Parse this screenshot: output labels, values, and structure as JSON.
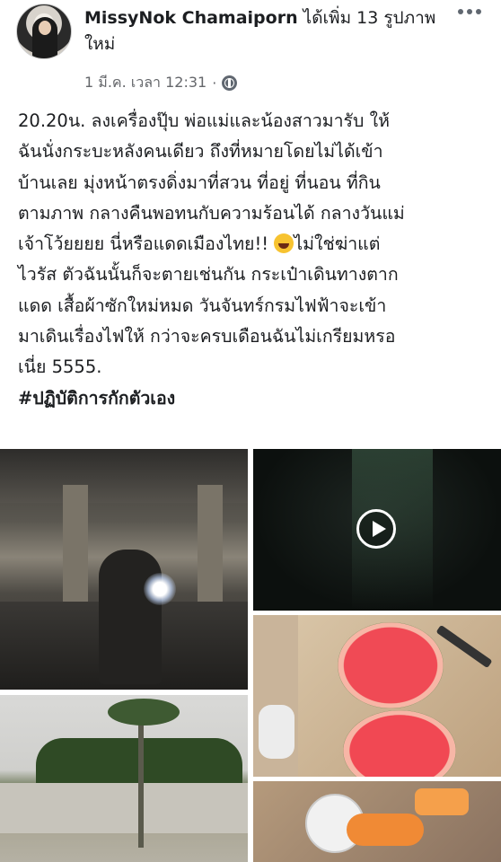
{
  "post": {
    "author": "MissyNok Chamaiporn",
    "action": "ได้เพิ่ม 13 รูปภาพใหม่",
    "timestamp": "1 มี.ค. เวลา 12:31",
    "separator": "·",
    "privacy_icon": "globe-icon",
    "more_icon": "more-options-icon",
    "text_lines": [
      "20.20น. ลงเครื่องปุ๊บ พ่อแม่และน้องสาวมารับ ให้",
      "ฉันนั่งกระบะหลังคนเดียว ถึงที่หมายโดยไม่ได้เข้า",
      "บ้านเลย มุ่งหน้าตรงดิ่งมาที่สวน ที่อยู่ ที่นอน ที่กิน",
      "ตามภาพ กลางคืนพอทนกับความร้อนได้ กลางวันแม่",
      "เจ้าโว้ยยยย นี่หรือแดดเมืองไทย!!",
      "ไม่ใช่ฆ่าแต่",
      "ไวรัส ตัวฉันนั้นก็จะตายเช่นกัน กระเป๋าเดินทางตาก",
      "แดด เสื้อผ้าซักใหม่หมด วันจันทร์กรมไฟฟ้าจะเข้า",
      "มาเดินเรื่องไฟให้ กว่าจะครบเดือนฉันไม่เกรียมหรอ",
      "เนี่ย 5555."
    ],
    "emoji_icon": "laughing-emoji-icon",
    "hashtag": "#ปฏิบัติการกักตัวเอง"
  },
  "gallery": {
    "photos": [
      {
        "name": "photo-night-truck",
        "description_icon": "photo"
      },
      {
        "name": "video-night",
        "play_icon": "play-icon"
      },
      {
        "name": "photo-watermelon",
        "description_icon": "photo"
      },
      {
        "name": "photo-garden",
        "description_icon": "photo"
      },
      {
        "name": "photo-papaya",
        "description_icon": "photo"
      }
    ]
  }
}
